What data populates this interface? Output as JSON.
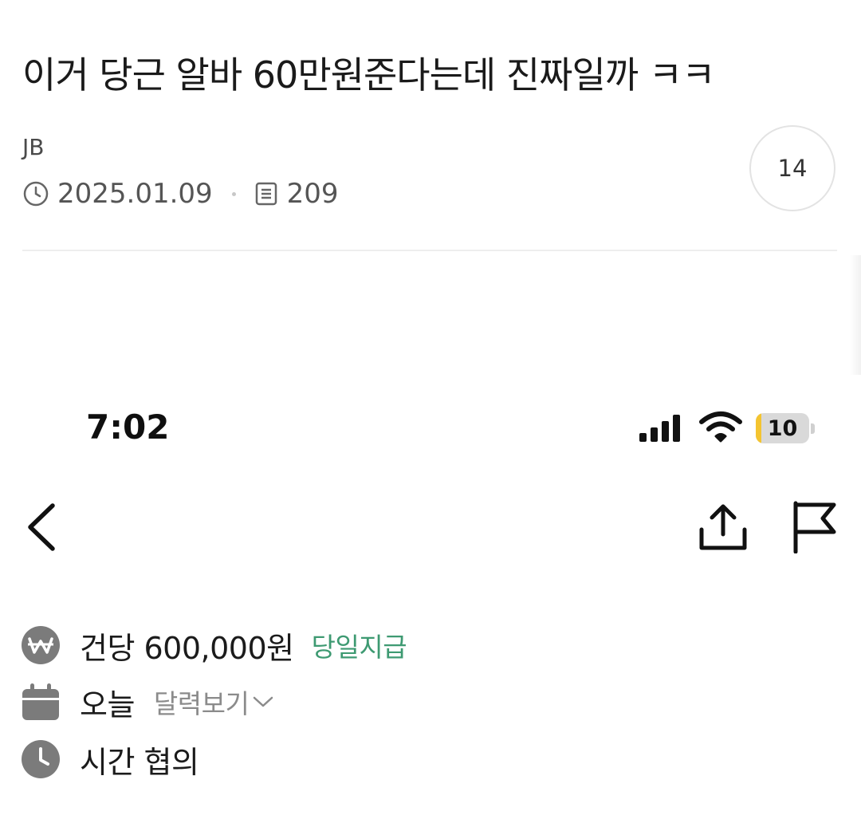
{
  "post": {
    "title": "이거 당근 알바 60만원준다는데 진짜일까 ㅋㅋ",
    "author": "JB",
    "date": "2025.01.09",
    "views": "209",
    "comment_count": "14"
  },
  "screenshot": {
    "status_bar": {
      "time": "7:02",
      "battery_level": "10",
      "battery_fraction": 0.1,
      "battery_color": "#f4c430"
    },
    "nav": {
      "back_icon": "chevron-left-icon",
      "share_icon": "share-icon",
      "report_icon": "flag-icon"
    },
    "job": {
      "pay_text": "건당 600,000원",
      "pay_badge": "당일지급",
      "pay_badge_color": "#3e9a72",
      "date_text": "오늘",
      "calendar_link": "달력보기",
      "time_text": "시간 협의"
    }
  }
}
